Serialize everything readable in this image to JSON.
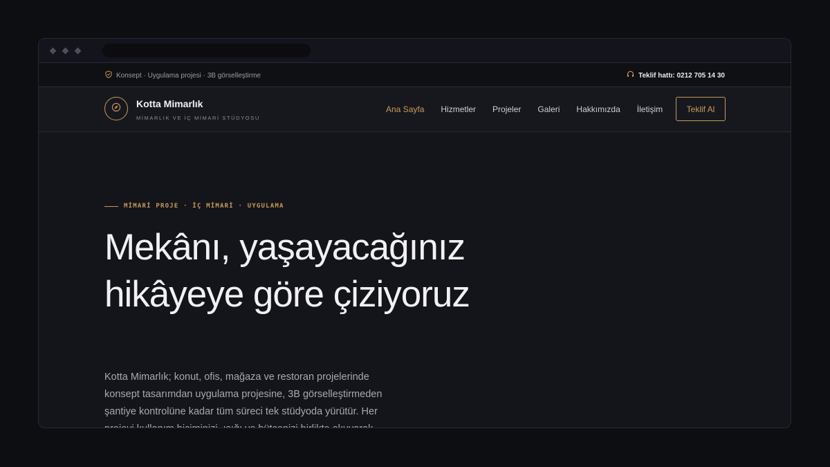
{
  "topbar": {
    "tagline": "Konsept · Uygulama projesi · 3B görselleştirme",
    "phone": "Teklif hattı: 0212 705 14 30"
  },
  "brand": {
    "name": "Kotta Mimarlık",
    "tagline": "MİMARLIK VE İÇ MİMARİ STÜDYOSU"
  },
  "nav": {
    "items": [
      {
        "label": "Ana Sayfa",
        "active": true
      },
      {
        "label": "Hizmetler"
      },
      {
        "label": "Projeler"
      },
      {
        "label": "Galeri"
      },
      {
        "label": "Hakkımızda"
      },
      {
        "label": "İletişim"
      }
    ],
    "cta": "Teklif Al"
  },
  "hero": {
    "eyebrow": "MİMARİ PROJE · İÇ MİMARİ · UYGULAMA",
    "headline": "Mekânı, yaşayacağınız hikâyeye göre çiziyoruz",
    "intro": "Kotta Mimarlık; konut, ofis, mağaza ve restoran projelerinde konsept tasarımdan uygulama projesine, 3B görselleştirmeden şantiye kontrolüne kadar tüm süreci tek stüdyoda yürütür. Her projeyi kullanım biçiminizi, ışığı ve bütçenizi birlikte okuyarak"
  },
  "colors": {
    "accent": "#c99a5b",
    "background": "#14151a"
  },
  "icons": {
    "topbar_left": "shield-check-icon",
    "topbar_right": "headset-icon",
    "logo": "compass-icon"
  }
}
